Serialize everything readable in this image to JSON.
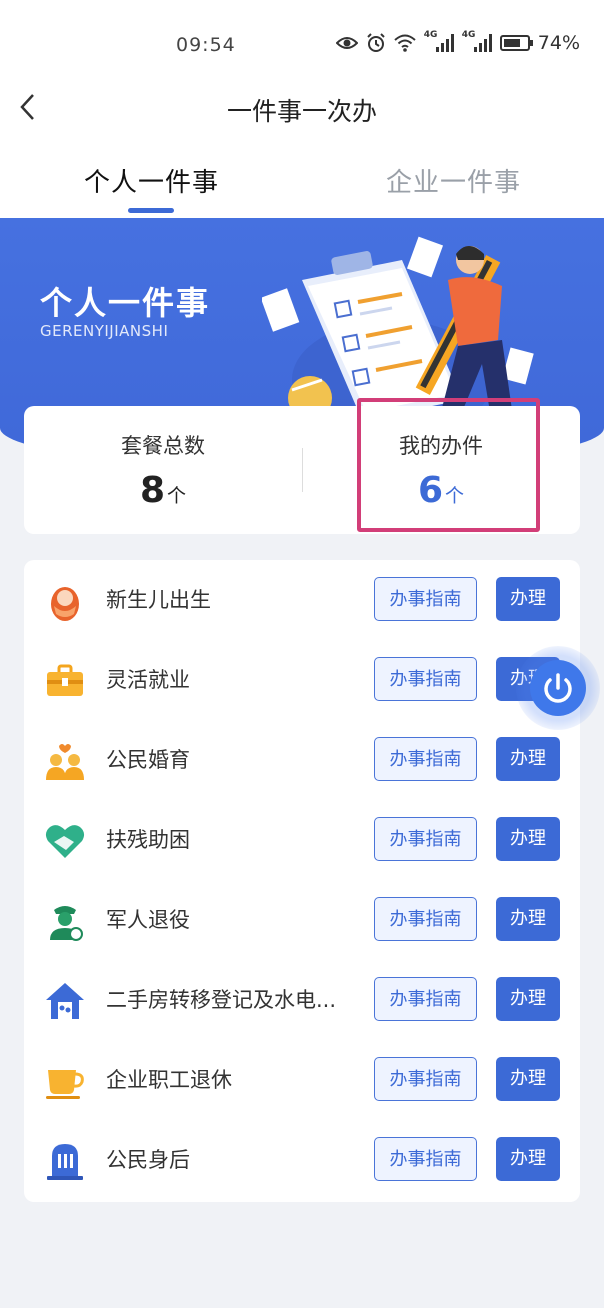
{
  "status_bar": {
    "time": "09:54",
    "network_label": "4G",
    "battery_percent": "74%",
    "battery_level": 0.74
  },
  "navbar": {
    "back_glyph": "‹",
    "title": "一件事一次办"
  },
  "tabs": [
    {
      "label": "个人一件事",
      "active": true
    },
    {
      "label": "企业一件事",
      "active": false
    }
  ],
  "banner": {
    "title": "个人一件事",
    "subtitle": "GERENYIJIANSHI"
  },
  "stats": {
    "total": {
      "label": "套餐总数",
      "value": "8",
      "unit": "个"
    },
    "mine": {
      "label": "我的办件",
      "value": "6",
      "unit": "个"
    }
  },
  "items": [
    {
      "name": "新生儿出生",
      "icon": "baby-icon",
      "guide_label": "办事指南",
      "action_label": "办理"
    },
    {
      "name": "灵活就业",
      "icon": "briefcase-icon",
      "guide_label": "办事指南",
      "action_label": "办理"
    },
    {
      "name": "公民婚育",
      "icon": "couple-icon",
      "guide_label": "办事指南",
      "action_label": "办理"
    },
    {
      "name": "扶残助困",
      "icon": "handshake-icon",
      "guide_label": "办事指南",
      "action_label": "办理"
    },
    {
      "name": "军人退役",
      "icon": "soldier-icon",
      "guide_label": "办事指南",
      "action_label": "办理"
    },
    {
      "name": "二手房转移登记及水电...",
      "icon": "house-icon",
      "guide_label": "办事指南",
      "action_label": "办理"
    },
    {
      "name": "企业职工退休",
      "icon": "teacup-icon",
      "guide_label": "办事指南",
      "action_label": "办理"
    },
    {
      "name": "公民身后",
      "icon": "tombstone-icon",
      "guide_label": "办事指南",
      "action_label": "办理"
    }
  ],
  "colors": {
    "accent": "#3c6ad6",
    "highlight": "#d23e78"
  }
}
